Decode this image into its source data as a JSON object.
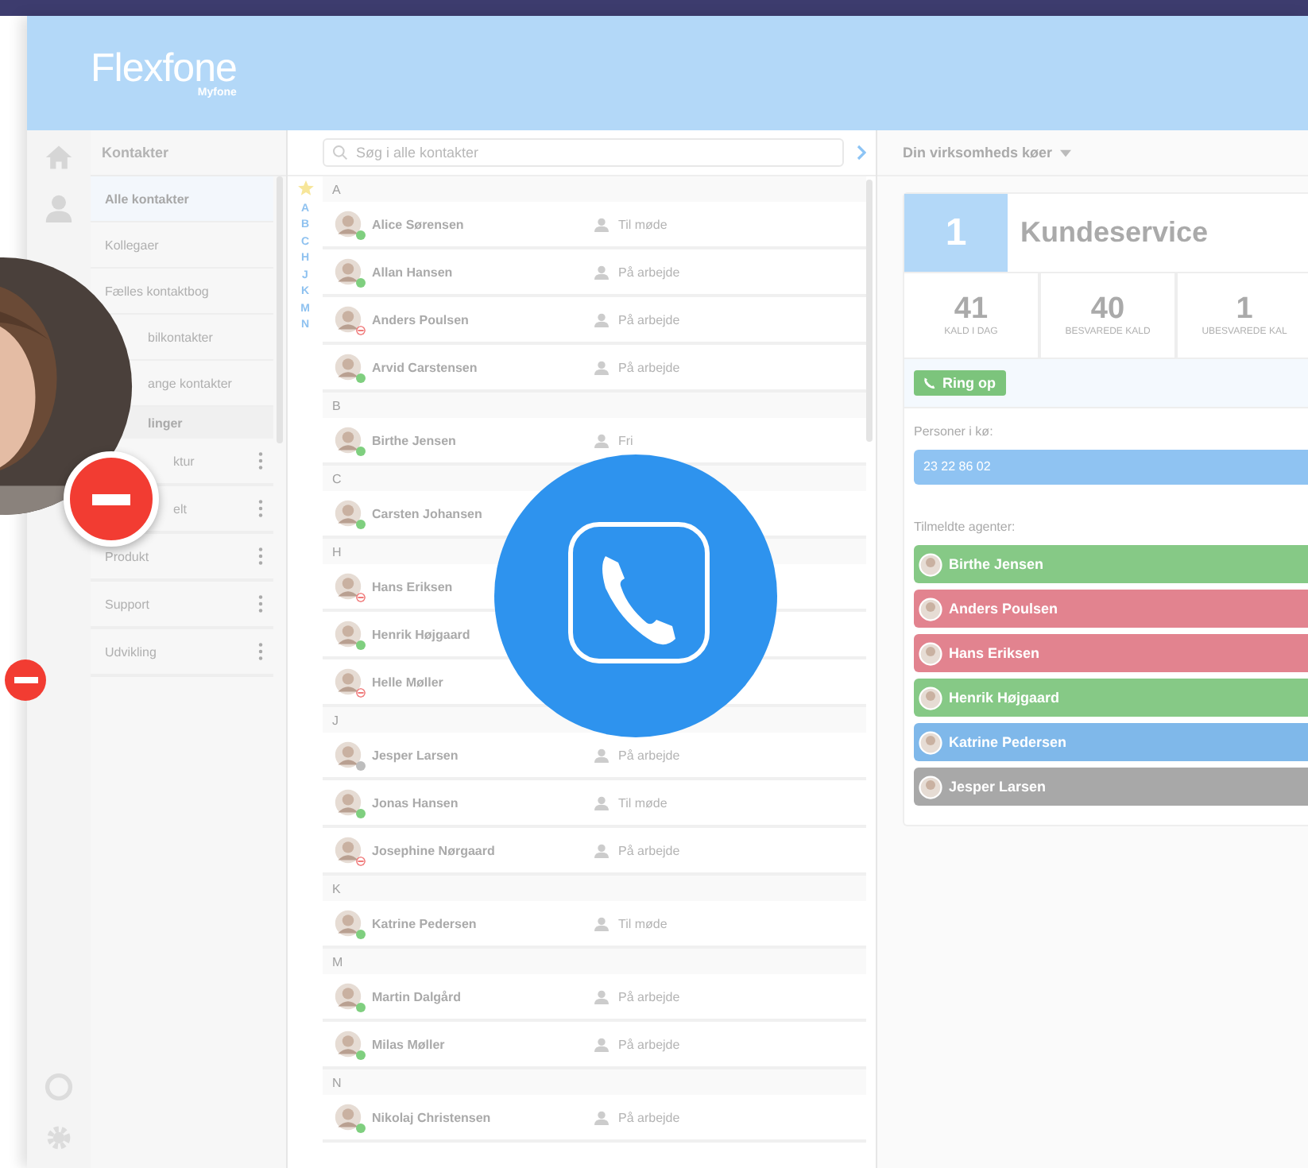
{
  "logo": {
    "name": "**Flex**fone",
    "sub": "Myfone"
  },
  "nav": {
    "title": "Kontakter",
    "items": [
      {
        "label": "Alle kontakter",
        "selected": true
      },
      {
        "label": "Kollegaer",
        "selected": false
      },
      {
        "label": "Fælles kontaktbog",
        "selected": false
      },
      {
        "label": "bilkontakter",
        "selected": false
      },
      {
        "label": "ange kontakter",
        "selected": false
      }
    ],
    "section": "linger",
    "groups": [
      {
        "label": "ktur"
      },
      {
        "label": "elt"
      },
      {
        "label": "Produkt"
      },
      {
        "label": "Support"
      },
      {
        "label": "Udvikling"
      }
    ]
  },
  "search": {
    "placeholder": "Søg i alle kontakter"
  },
  "index": [
    "A",
    "B",
    "C",
    "H",
    "J",
    "K",
    "M",
    "N"
  ],
  "contacts": [
    {
      "letter": "A",
      "rows": [
        {
          "name": "Alice Sørensen",
          "kind": "dot",
          "color": "#7fcf7f",
          "status": "Til møde"
        },
        {
          "name": "Allan Hansen",
          "kind": "dot",
          "color": "#7fcf7f",
          "status": "På arbejde"
        },
        {
          "name": "Anders Poulsen",
          "kind": "busy",
          "color": "#f07a7a",
          "status": "På arbejde"
        },
        {
          "name": "Arvid Carstensen",
          "kind": "dot",
          "color": "#7fcf7f",
          "status": "På arbejde"
        }
      ]
    },
    {
      "letter": "B",
      "rows": [
        {
          "name": "Birthe Jensen",
          "kind": "dot",
          "color": "#7fcf7f",
          "status": "Fri"
        }
      ]
    },
    {
      "letter": "C",
      "rows": [
        {
          "name": "Carsten Johansen",
          "kind": "dot",
          "color": "#7fcf7f"
        }
      ]
    },
    {
      "letter": "H",
      "rows": [
        {
          "name": "Hans Eriksen",
          "kind": "busy",
          "color": "#f07a7a"
        },
        {
          "name": "Henrik Højgaard",
          "kind": "dot",
          "color": "#7fcf7f"
        },
        {
          "name": "Helle Møller",
          "kind": "busy",
          "color": "#f07a7a"
        }
      ]
    },
    {
      "letter": "J",
      "rows": [
        {
          "name": "Jesper Larsen",
          "kind": "dot",
          "color": "#bdbdbd",
          "status": "På arbejde"
        },
        {
          "name": "Jonas Hansen",
          "kind": "dot",
          "color": "#7fcf7f",
          "status": "Til møde"
        },
        {
          "name": "Josephine Nørgaard",
          "kind": "busy",
          "color": "#f07a7a",
          "status": "På arbejde"
        }
      ]
    },
    {
      "letter": "K",
      "rows": [
        {
          "name": "Katrine Pedersen",
          "kind": "dot",
          "color": "#7fcf7f",
          "status": "Til møde"
        }
      ]
    },
    {
      "letter": "M",
      "rows": [
        {
          "name": "Martin Dalgård",
          "kind": "dot",
          "color": "#7fcf7f",
          "status": "På arbejde"
        },
        {
          "name": "Milas Møller",
          "kind": "dot",
          "color": "#7fcf7f",
          "status": "På arbejde"
        }
      ]
    },
    {
      "letter": "N",
      "rows": [
        {
          "name": "Nikolaj Christensen",
          "kind": "dot",
          "color": "#7fcf7f",
          "status": "På arbejde"
        }
      ]
    }
  ],
  "queues": {
    "title": "Din virksomheds køer",
    "count": "1",
    "name": "Kundeservice",
    "stats": [
      {
        "value": "41",
        "label": "KALD I DAG"
      },
      {
        "value": "40",
        "label": "BESVAREDE KALD"
      },
      {
        "value": "1",
        "label": "UBESVAREDE KAL"
      }
    ],
    "call_button": "Ring op",
    "waiting_label": "Personer i kø:",
    "waiting": [
      "23 22 86 02"
    ],
    "agents_label": "Tilmeldte agenter:",
    "agents": [
      {
        "name": "Birthe Jensen",
        "color": "#86c986"
      },
      {
        "name": "Anders Poulsen",
        "color": "#e2838f"
      },
      {
        "name": "Hans Eriksen",
        "color": "#e2838f"
      },
      {
        "name": "Henrik Højgaard",
        "color": "#86c986"
      },
      {
        "name": "Katrine Pedersen",
        "color": "#7fb8ea"
      },
      {
        "name": "Jesper Larsen",
        "color": "#a8a8a8"
      }
    ]
  }
}
